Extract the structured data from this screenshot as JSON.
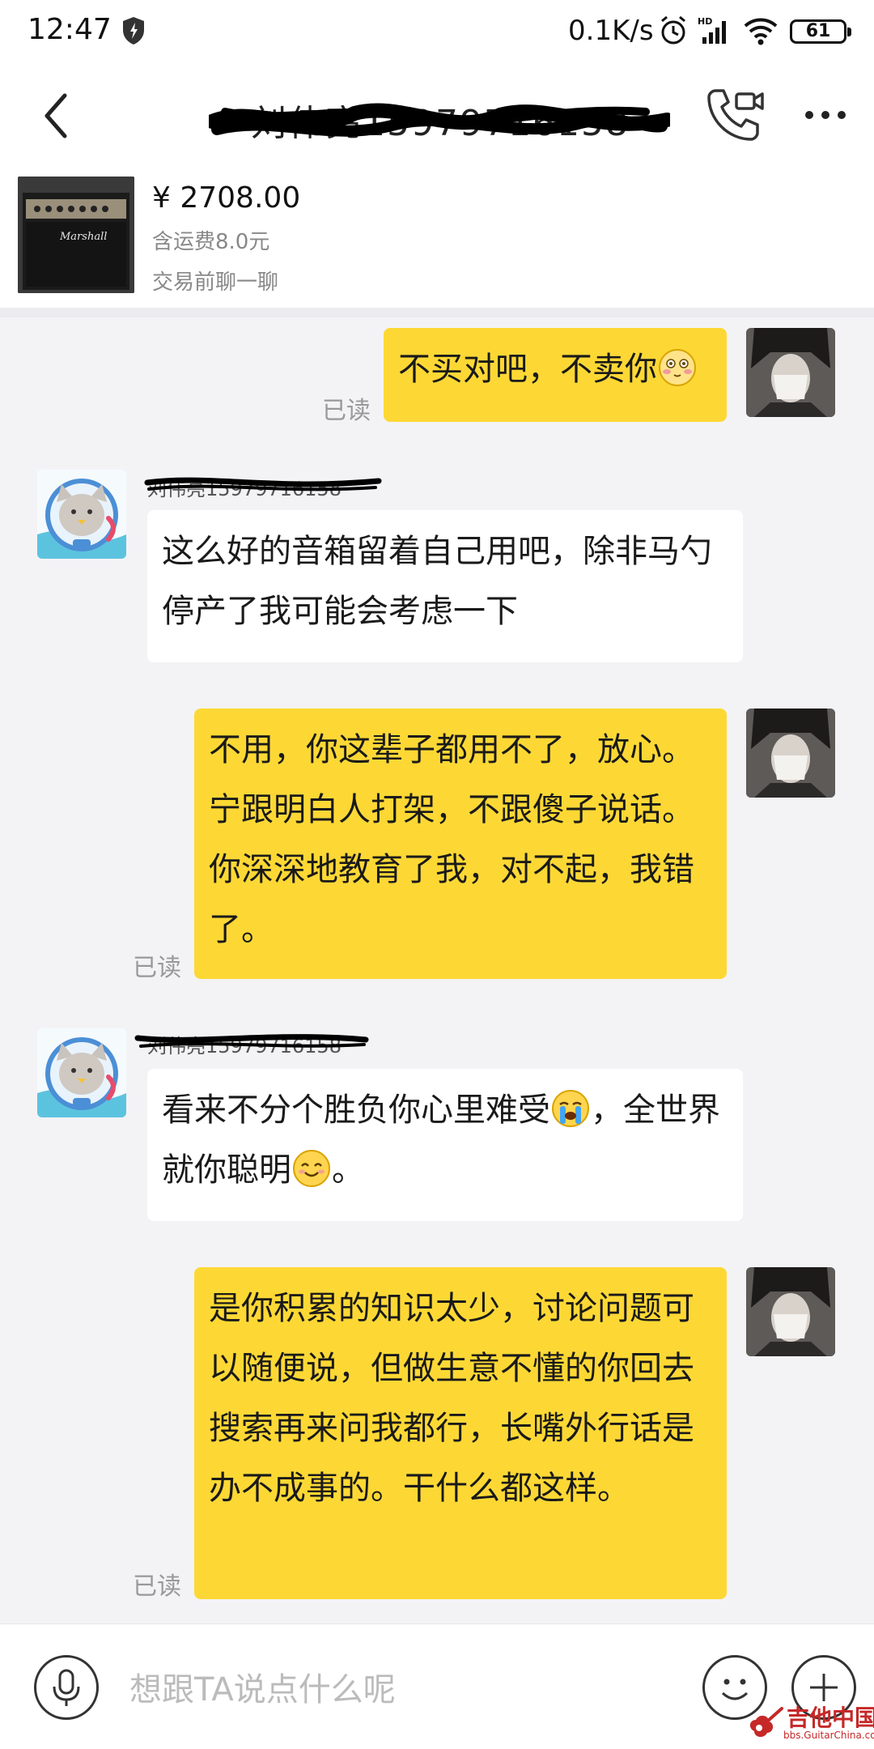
{
  "status_bar": {
    "time": "12:47",
    "net_speed": "0.1K/s",
    "battery_level": "61",
    "icons": [
      "shield-icon",
      "alarm-icon",
      "signal-hd-icon",
      "wifi-icon",
      "battery-icon"
    ]
  },
  "header": {
    "title": "刘伟亮15979716158",
    "title_redacted": true,
    "icons": [
      "back-icon",
      "video-call-icon",
      "more-icon"
    ]
  },
  "product": {
    "price": "¥ 2708.00",
    "shipping": "含运费8.0元",
    "hint": "交易前聊一聊",
    "thumb_brand": "Marshall"
  },
  "messages": [
    {
      "from": "self",
      "read": "已读",
      "text": "不买对吧，不卖你",
      "emoji_after": "blush-emoji"
    },
    {
      "from": "other",
      "sender": "刘伟亮15979716158",
      "text": "这么好的音箱留着自己用吧，除非马勺停产了我可能会考虑一下"
    },
    {
      "from": "self",
      "read": "已读",
      "text": "不用，你这辈子都用不了，放心。宁跟明白人打架，不跟傻子说话。你深深地教育了我，对不起，我错了。"
    },
    {
      "from": "other",
      "sender": "刘伟亮15979716158",
      "text_before_emoji": "看来不分个胜负你心里难受",
      "emoji_1": "crying-emoji",
      "text_middle": "，全世界就你聪明",
      "emoji_2": "smile-emoji",
      "text_after": "。"
    },
    {
      "from": "self",
      "read": "已读",
      "text": "是你积累的知识太少，讨论问题可以随便说，但做生意不懂的你回去搜索再来问我都行，长嘴外行话是办不成事的。干什么都这样。"
    }
  ],
  "input_bar": {
    "placeholder": "想跟TA说点什么呢",
    "icons": [
      "microphone-icon",
      "emoji-icon",
      "plus-icon"
    ]
  },
  "watermark": {
    "title": "吉他中国",
    "subtitle": "bbs.GuitarChina.com"
  },
  "colors": {
    "self_bubble": "#fdd835",
    "other_bubble": "#ffffff",
    "background": "#f3f3f6",
    "read_receipt": "#999999"
  }
}
